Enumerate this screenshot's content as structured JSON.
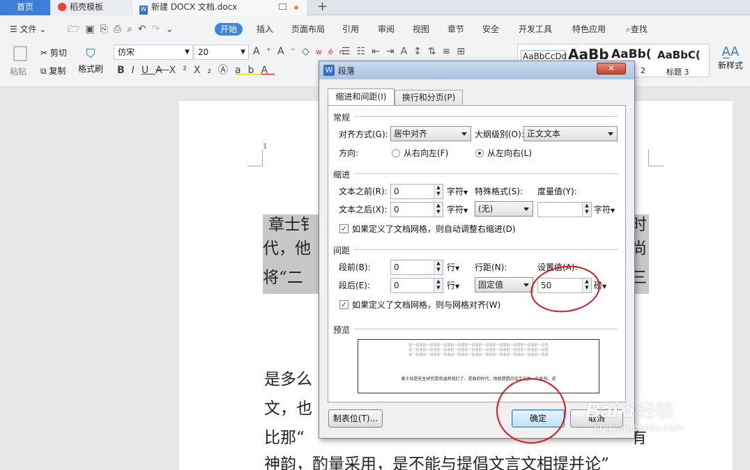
{
  "tabs": {
    "home": "首页",
    "daoke": "稻壳模板",
    "doc": "新建 DOCX 文档.docx"
  },
  "menu": {
    "file": "文件",
    "items": [
      "开始",
      "插入",
      "页面布局",
      "引用",
      "审阅",
      "视图",
      "章节",
      "安全",
      "开发工具",
      "特色应用"
    ],
    "search": "查找"
  },
  "ribbon": {
    "paste": "粘贴",
    "cut": "剪切",
    "copy": "复制",
    "format_painter": "格式刷",
    "font_name": "仿宋",
    "font_size": "20",
    "styles": [
      "AaBbCcDd",
      "AaBb",
      "AaBb(",
      "AaBbC("
    ],
    "style_labels": [
      "2",
      "标题 3"
    ],
    "new_style": "新样式"
  },
  "document": {
    "page_number": "1",
    "lines_left": [
      "章士钅",
      "代，他",
      "将“二"
    ],
    "lines_right": [
      "时",
      "尚",
      "三"
    ],
    "body_left": [
      "是多么",
      "文，也"
    ],
    "line3": "比那“",
    "line3_right": "有",
    "line4": "神韵，酌量采用，是不能与提倡文言文相提并论”"
  },
  "dialog": {
    "title": "段落",
    "tabs": [
      "缩进和间距(I)",
      "换行和分页(P)"
    ],
    "general": {
      "section": "常规",
      "align_label": "对齐方式(G):",
      "align_value": "居中对齐",
      "outline_label": "大纲级别(O):",
      "outline_value": "正文文本",
      "direction_label": "方向:",
      "rtl": "从右向左(F)",
      "ltr": "从左向右(L)"
    },
    "indent": {
      "section": "缩进",
      "before_label": "文本之前(R):",
      "before_value": "0",
      "before_unit": "字符",
      "after_label": "文本之后(X):",
      "after_value": "0",
      "after_unit": "字符",
      "special_label": "特殊格式(S):",
      "special_value": "(无)",
      "measure_label": "度量值(Y):",
      "measure_unit": "字符",
      "grid_check": "如果定义了文档网格，则自动调整右缩进(D)"
    },
    "spacing": {
      "section": "间距",
      "before_label": "段前(B):",
      "before_value": "0",
      "before_unit": "行",
      "after_label": "段后(E):",
      "after_value": "0",
      "after_unit": "行",
      "line_label": "行距(N):",
      "line_value": "固定值",
      "set_label": "设置值(A):",
      "set_value": "50",
      "set_unit": "磅",
      "grid_check": "如果定义了文档网格，则与网格对齐(W)"
    },
    "preview": {
      "section": "预览",
      "prev_text": "前一段落前一段落前一段落前一段落前一段落前一段落前一段落前一段落前一段落前一段落",
      "main_text": "章士钊是先生研究是否涵养我们了，是政府时代，他就提倡白话文论并一个系列，说"
    },
    "buttons": {
      "tabs": "制表位(T)...",
      "ok": "确定",
      "cancel": "取消"
    }
  },
  "watermark": {
    "brand": "Bai",
    "brand2": "经验",
    "url": "jingyan.baidu.com"
  },
  "colors": {
    "accent": "#3d86e6",
    "annotation": "#e0141e"
  }
}
